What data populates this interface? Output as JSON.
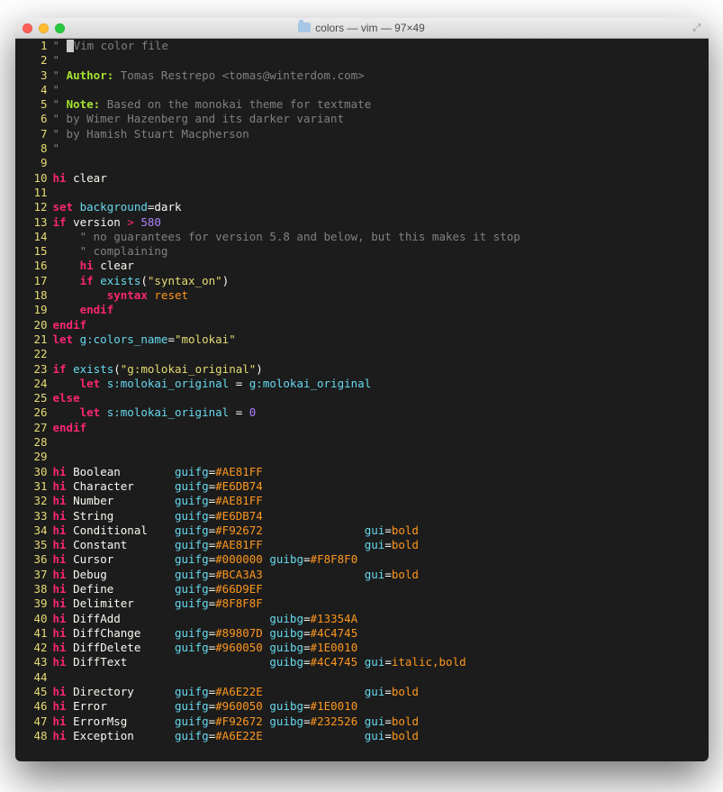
{
  "window": {
    "title": "colors — vim — 97×49"
  },
  "lines": [
    {
      "n": "1",
      "seg": [
        {
          "t": "\" ",
          "c": "c-gray"
        },
        {
          "t": "",
          "cursor": true
        },
        {
          "t": "Vim color file",
          "c": "c-gray"
        }
      ]
    },
    {
      "n": "2",
      "seg": [
        {
          "t": "\"",
          "c": "c-gray"
        }
      ]
    },
    {
      "n": "3",
      "seg": [
        {
          "t": "\" ",
          "c": "c-gray"
        },
        {
          "t": "Author:",
          "c": "c-green b"
        },
        {
          "t": " Tomas Restrepo <tomas@winterdom.com>",
          "c": "c-gray"
        }
      ]
    },
    {
      "n": "4",
      "seg": [
        {
          "t": "\"",
          "c": "c-gray"
        }
      ]
    },
    {
      "n": "5",
      "seg": [
        {
          "t": "\" ",
          "c": "c-gray"
        },
        {
          "t": "Note:",
          "c": "c-green b"
        },
        {
          "t": " Based on the monokai theme for textmate",
          "c": "c-gray"
        }
      ]
    },
    {
      "n": "6",
      "seg": [
        {
          "t": "\" by Wimer Hazenberg and its darker variant",
          "c": "c-gray"
        }
      ]
    },
    {
      "n": "7",
      "seg": [
        {
          "t": "\" by Hamish Stuart Macpherson",
          "c": "c-gray"
        }
      ]
    },
    {
      "n": "8",
      "seg": [
        {
          "t": "\"",
          "c": "c-gray"
        }
      ]
    },
    {
      "n": "9",
      "seg": []
    },
    {
      "n": "10",
      "seg": [
        {
          "t": "hi",
          "c": "c-pink b"
        },
        {
          "t": " clear",
          "c": "c-white"
        }
      ]
    },
    {
      "n": "11",
      "seg": []
    },
    {
      "n": "12",
      "seg": [
        {
          "t": "set",
          "c": "c-pink b"
        },
        {
          "t": " ",
          "c": ""
        },
        {
          "t": "background",
          "c": "c-cyan"
        },
        {
          "t": "=",
          "c": "c-white"
        },
        {
          "t": "dark",
          "c": "c-white"
        }
      ]
    },
    {
      "n": "13",
      "seg": [
        {
          "t": "if",
          "c": "c-pink b"
        },
        {
          "t": " version ",
          "c": "c-white"
        },
        {
          "t": ">",
          "c": "c-pink"
        },
        {
          "t": " ",
          "c": ""
        },
        {
          "t": "580",
          "c": "c-purple"
        }
      ]
    },
    {
      "n": "14",
      "seg": [
        {
          "t": "    \" no guarantees for version 5.8 and below, but this makes it stop",
          "c": "c-gray"
        }
      ]
    },
    {
      "n": "15",
      "seg": [
        {
          "t": "    \" complaining",
          "c": "c-gray"
        }
      ]
    },
    {
      "n": "16",
      "seg": [
        {
          "t": "    ",
          "c": ""
        },
        {
          "t": "hi",
          "c": "c-pink b"
        },
        {
          "t": " clear",
          "c": "c-white"
        }
      ]
    },
    {
      "n": "17",
      "seg": [
        {
          "t": "    ",
          "c": ""
        },
        {
          "t": "if",
          "c": "c-pink b"
        },
        {
          "t": " ",
          "c": ""
        },
        {
          "t": "exists",
          "c": "c-cyan"
        },
        {
          "t": "(",
          "c": "c-white"
        },
        {
          "t": "\"syntax_on\"",
          "c": "c-yellow"
        },
        {
          "t": ")",
          "c": "c-white"
        }
      ]
    },
    {
      "n": "18",
      "seg": [
        {
          "t": "        ",
          "c": ""
        },
        {
          "t": "syntax",
          "c": "c-pink b"
        },
        {
          "t": " ",
          "c": ""
        },
        {
          "t": "reset",
          "c": "c-orange"
        }
      ]
    },
    {
      "n": "19",
      "seg": [
        {
          "t": "    ",
          "c": ""
        },
        {
          "t": "endif",
          "c": "c-pink b"
        }
      ]
    },
    {
      "n": "20",
      "seg": [
        {
          "t": "endif",
          "c": "c-pink b"
        }
      ]
    },
    {
      "n": "21",
      "seg": [
        {
          "t": "let",
          "c": "c-pink b"
        },
        {
          "t": " ",
          "c": ""
        },
        {
          "t": "g:colors_name",
          "c": "c-cyan"
        },
        {
          "t": "=",
          "c": "c-white"
        },
        {
          "t": "\"molokai\"",
          "c": "c-yellow"
        }
      ]
    },
    {
      "n": "22",
      "seg": []
    },
    {
      "n": "23",
      "seg": [
        {
          "t": "if",
          "c": "c-pink b"
        },
        {
          "t": " ",
          "c": ""
        },
        {
          "t": "exists",
          "c": "c-cyan"
        },
        {
          "t": "(",
          "c": "c-white"
        },
        {
          "t": "\"g:molokai_original\"",
          "c": "c-yellow"
        },
        {
          "t": ")",
          "c": "c-white"
        }
      ]
    },
    {
      "n": "24",
      "seg": [
        {
          "t": "    ",
          "c": ""
        },
        {
          "t": "let",
          "c": "c-pink b"
        },
        {
          "t": " ",
          "c": ""
        },
        {
          "t": "s:molokai_original",
          "c": "c-cyan"
        },
        {
          "t": " = ",
          "c": "c-white"
        },
        {
          "t": "g:molokai_original",
          "c": "c-cyan"
        }
      ]
    },
    {
      "n": "25",
      "seg": [
        {
          "t": "else",
          "c": "c-pink b"
        }
      ]
    },
    {
      "n": "26",
      "seg": [
        {
          "t": "    ",
          "c": ""
        },
        {
          "t": "let",
          "c": "c-pink b"
        },
        {
          "t": " ",
          "c": ""
        },
        {
          "t": "s:molokai_original",
          "c": "c-cyan"
        },
        {
          "t": " = ",
          "c": "c-white"
        },
        {
          "t": "0",
          "c": "c-purple"
        }
      ]
    },
    {
      "n": "27",
      "seg": [
        {
          "t": "endif",
          "c": "c-pink b"
        }
      ]
    },
    {
      "n": "28",
      "seg": []
    },
    {
      "n": "29",
      "seg": []
    },
    {
      "n": "30",
      "seg": [
        {
          "t": "hi",
          "c": "c-pink b"
        },
        {
          "t": " Boolean        ",
          "c": "c-white"
        },
        {
          "t": "guifg",
          "c": "c-cyan"
        },
        {
          "t": "=",
          "c": "c-white"
        },
        {
          "t": "#AE81FF",
          "c": "c-orange"
        }
      ]
    },
    {
      "n": "31",
      "seg": [
        {
          "t": "hi",
          "c": "c-pink b"
        },
        {
          "t": " Character      ",
          "c": "c-white"
        },
        {
          "t": "guifg",
          "c": "c-cyan"
        },
        {
          "t": "=",
          "c": "c-white"
        },
        {
          "t": "#E6DB74",
          "c": "c-orange"
        }
      ]
    },
    {
      "n": "32",
      "seg": [
        {
          "t": "hi",
          "c": "c-pink b"
        },
        {
          "t": " Number         ",
          "c": "c-white"
        },
        {
          "t": "guifg",
          "c": "c-cyan"
        },
        {
          "t": "=",
          "c": "c-white"
        },
        {
          "t": "#AE81FF",
          "c": "c-orange"
        }
      ]
    },
    {
      "n": "33",
      "seg": [
        {
          "t": "hi",
          "c": "c-pink b"
        },
        {
          "t": " String         ",
          "c": "c-white"
        },
        {
          "t": "guifg",
          "c": "c-cyan"
        },
        {
          "t": "=",
          "c": "c-white"
        },
        {
          "t": "#E6DB74",
          "c": "c-orange"
        }
      ]
    },
    {
      "n": "34",
      "seg": [
        {
          "t": "hi",
          "c": "c-pink b"
        },
        {
          "t": " Conditional    ",
          "c": "c-white"
        },
        {
          "t": "guifg",
          "c": "c-cyan"
        },
        {
          "t": "=",
          "c": "c-white"
        },
        {
          "t": "#F92672",
          "c": "c-orange"
        },
        {
          "t": "               ",
          "c": ""
        },
        {
          "t": "gui",
          "c": "c-cyan"
        },
        {
          "t": "=",
          "c": "c-white"
        },
        {
          "t": "bold",
          "c": "c-orange"
        }
      ]
    },
    {
      "n": "35",
      "seg": [
        {
          "t": "hi",
          "c": "c-pink b"
        },
        {
          "t": " Constant       ",
          "c": "c-white"
        },
        {
          "t": "guifg",
          "c": "c-cyan"
        },
        {
          "t": "=",
          "c": "c-white"
        },
        {
          "t": "#AE81FF",
          "c": "c-orange"
        },
        {
          "t": "               ",
          "c": ""
        },
        {
          "t": "gui",
          "c": "c-cyan"
        },
        {
          "t": "=",
          "c": "c-white"
        },
        {
          "t": "bold",
          "c": "c-orange"
        }
      ]
    },
    {
      "n": "36",
      "seg": [
        {
          "t": "hi",
          "c": "c-pink b"
        },
        {
          "t": " Cursor         ",
          "c": "c-white"
        },
        {
          "t": "guifg",
          "c": "c-cyan"
        },
        {
          "t": "=",
          "c": "c-white"
        },
        {
          "t": "#000000",
          "c": "c-orange"
        },
        {
          "t": " ",
          "c": ""
        },
        {
          "t": "guibg",
          "c": "c-cyan"
        },
        {
          "t": "=",
          "c": "c-white"
        },
        {
          "t": "#F8F8F0",
          "c": "c-orange"
        }
      ]
    },
    {
      "n": "37",
      "seg": [
        {
          "t": "hi",
          "c": "c-pink b"
        },
        {
          "t": " Debug          ",
          "c": "c-white"
        },
        {
          "t": "guifg",
          "c": "c-cyan"
        },
        {
          "t": "=",
          "c": "c-white"
        },
        {
          "t": "#BCA3A3",
          "c": "c-orange"
        },
        {
          "t": "               ",
          "c": ""
        },
        {
          "t": "gui",
          "c": "c-cyan"
        },
        {
          "t": "=",
          "c": "c-white"
        },
        {
          "t": "bold",
          "c": "c-orange"
        }
      ]
    },
    {
      "n": "38",
      "seg": [
        {
          "t": "hi",
          "c": "c-pink b"
        },
        {
          "t": " Define         ",
          "c": "c-white"
        },
        {
          "t": "guifg",
          "c": "c-cyan"
        },
        {
          "t": "=",
          "c": "c-white"
        },
        {
          "t": "#66D9EF",
          "c": "c-orange"
        }
      ]
    },
    {
      "n": "39",
      "seg": [
        {
          "t": "hi",
          "c": "c-pink b"
        },
        {
          "t": " Delimiter      ",
          "c": "c-white"
        },
        {
          "t": "guifg",
          "c": "c-cyan"
        },
        {
          "t": "=",
          "c": "c-white"
        },
        {
          "t": "#8F8F8F",
          "c": "c-orange"
        }
      ]
    },
    {
      "n": "40",
      "seg": [
        {
          "t": "hi",
          "c": "c-pink b"
        },
        {
          "t": " DiffAdd                      ",
          "c": "c-white"
        },
        {
          "t": "guibg",
          "c": "c-cyan"
        },
        {
          "t": "=",
          "c": "c-white"
        },
        {
          "t": "#13354A",
          "c": "c-orange"
        }
      ]
    },
    {
      "n": "41",
      "seg": [
        {
          "t": "hi",
          "c": "c-pink b"
        },
        {
          "t": " DiffChange     ",
          "c": "c-white"
        },
        {
          "t": "guifg",
          "c": "c-cyan"
        },
        {
          "t": "=",
          "c": "c-white"
        },
        {
          "t": "#89807D",
          "c": "c-orange"
        },
        {
          "t": " ",
          "c": ""
        },
        {
          "t": "guibg",
          "c": "c-cyan"
        },
        {
          "t": "=",
          "c": "c-white"
        },
        {
          "t": "#4C4745",
          "c": "c-orange"
        }
      ]
    },
    {
      "n": "42",
      "seg": [
        {
          "t": "hi",
          "c": "c-pink b"
        },
        {
          "t": " DiffDelete     ",
          "c": "c-white"
        },
        {
          "t": "guifg",
          "c": "c-cyan"
        },
        {
          "t": "=",
          "c": "c-white"
        },
        {
          "t": "#960050",
          "c": "c-orange"
        },
        {
          "t": " ",
          "c": ""
        },
        {
          "t": "guibg",
          "c": "c-cyan"
        },
        {
          "t": "=",
          "c": "c-white"
        },
        {
          "t": "#1E0010",
          "c": "c-orange"
        }
      ]
    },
    {
      "n": "43",
      "seg": [
        {
          "t": "hi",
          "c": "c-pink b"
        },
        {
          "t": " DiffText                     ",
          "c": "c-white"
        },
        {
          "t": "guibg",
          "c": "c-cyan"
        },
        {
          "t": "=",
          "c": "c-white"
        },
        {
          "t": "#4C4745",
          "c": "c-orange"
        },
        {
          "t": " ",
          "c": ""
        },
        {
          "t": "gui",
          "c": "c-cyan"
        },
        {
          "t": "=",
          "c": "c-white"
        },
        {
          "t": "italic,bold",
          "c": "c-orange"
        }
      ]
    },
    {
      "n": "44",
      "seg": []
    },
    {
      "n": "45",
      "seg": [
        {
          "t": "hi",
          "c": "c-pink b"
        },
        {
          "t": " Directory      ",
          "c": "c-white"
        },
        {
          "t": "guifg",
          "c": "c-cyan"
        },
        {
          "t": "=",
          "c": "c-white"
        },
        {
          "t": "#A6E22E",
          "c": "c-orange"
        },
        {
          "t": "               ",
          "c": ""
        },
        {
          "t": "gui",
          "c": "c-cyan"
        },
        {
          "t": "=",
          "c": "c-white"
        },
        {
          "t": "bold",
          "c": "c-orange"
        }
      ]
    },
    {
      "n": "46",
      "seg": [
        {
          "t": "hi",
          "c": "c-pink b"
        },
        {
          "t": " Error          ",
          "c": "c-white"
        },
        {
          "t": "guifg",
          "c": "c-cyan"
        },
        {
          "t": "=",
          "c": "c-white"
        },
        {
          "t": "#960050",
          "c": "c-orange"
        },
        {
          "t": " ",
          "c": ""
        },
        {
          "t": "guibg",
          "c": "c-cyan"
        },
        {
          "t": "=",
          "c": "c-white"
        },
        {
          "t": "#1E0010",
          "c": "c-orange"
        }
      ]
    },
    {
      "n": "47",
      "seg": [
        {
          "t": "hi",
          "c": "c-pink b"
        },
        {
          "t": " ErrorMsg       ",
          "c": "c-white"
        },
        {
          "t": "guifg",
          "c": "c-cyan"
        },
        {
          "t": "=",
          "c": "c-white"
        },
        {
          "t": "#F92672",
          "c": "c-orange"
        },
        {
          "t": " ",
          "c": ""
        },
        {
          "t": "guibg",
          "c": "c-cyan"
        },
        {
          "t": "=",
          "c": "c-white"
        },
        {
          "t": "#232526",
          "c": "c-orange"
        },
        {
          "t": " ",
          "c": ""
        },
        {
          "t": "gui",
          "c": "c-cyan"
        },
        {
          "t": "=",
          "c": "c-white"
        },
        {
          "t": "bold",
          "c": "c-orange"
        }
      ]
    },
    {
      "n": "48",
      "seg": [
        {
          "t": "hi",
          "c": "c-pink b"
        },
        {
          "t": " Exception      ",
          "c": "c-white"
        },
        {
          "t": "guifg",
          "c": "c-cyan"
        },
        {
          "t": "=",
          "c": "c-white"
        },
        {
          "t": "#A6E22E",
          "c": "c-orange"
        },
        {
          "t": "               ",
          "c": ""
        },
        {
          "t": "gui",
          "c": "c-cyan"
        },
        {
          "t": "=",
          "c": "c-white"
        },
        {
          "t": "bold",
          "c": "c-orange"
        }
      ]
    }
  ]
}
